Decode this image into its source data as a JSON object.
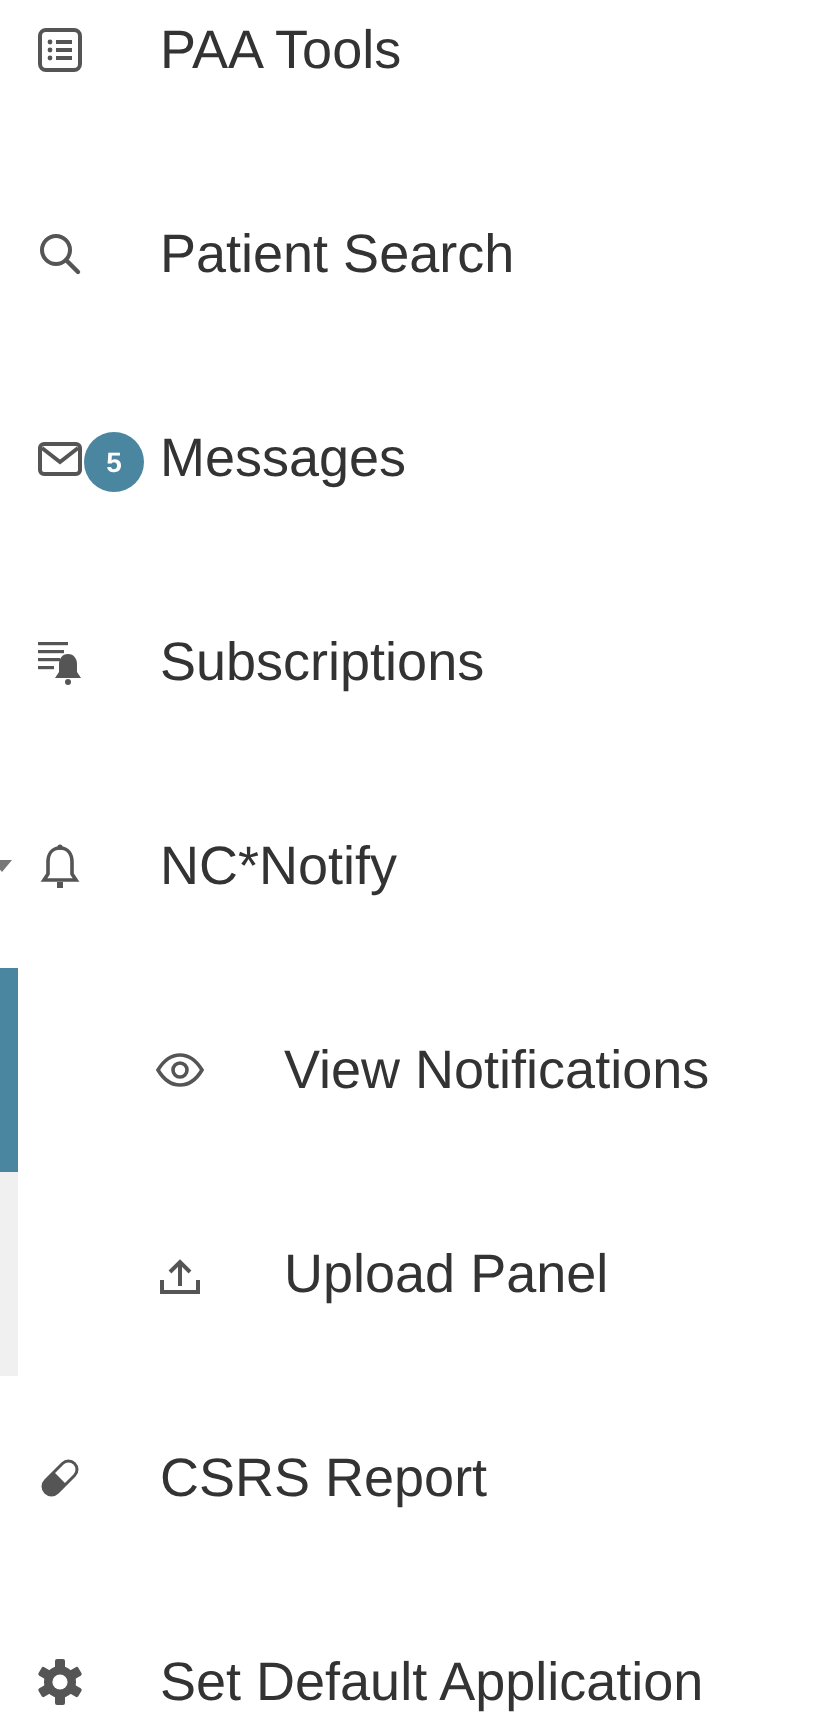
{
  "menu": {
    "items": [
      {
        "label": "PAA Tools"
      },
      {
        "label": "Patient Search"
      },
      {
        "label": "Messages",
        "badge": "5"
      },
      {
        "label": "Subscriptions"
      },
      {
        "label": "NC*Notify",
        "expanded": true,
        "children": [
          {
            "label": "View Notifications",
            "selected": true
          },
          {
            "label": "Upload Panel",
            "selected": false
          }
        ]
      },
      {
        "label": "CSRS Report"
      },
      {
        "label": "Set Default Application"
      }
    ]
  }
}
